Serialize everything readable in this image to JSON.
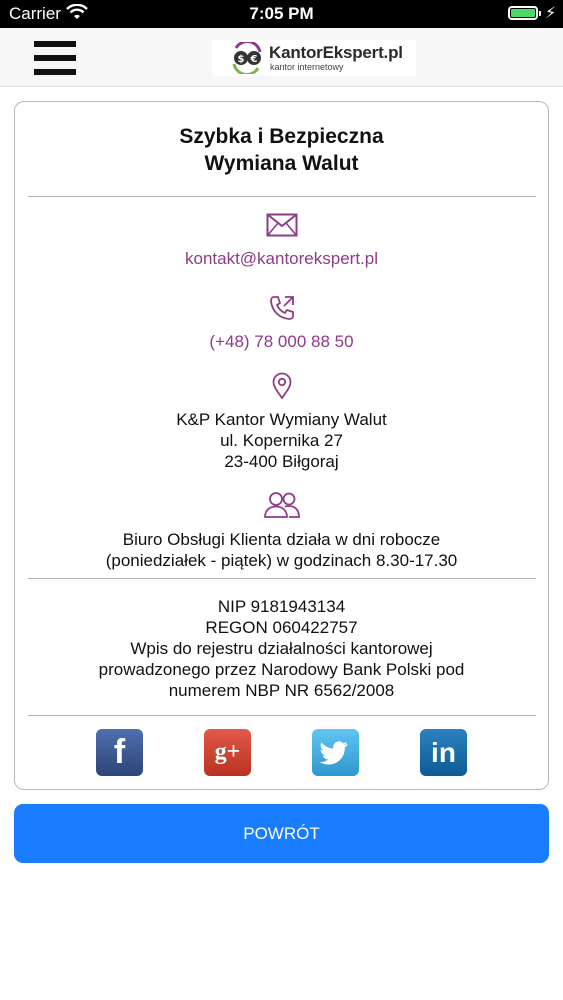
{
  "status_bar": {
    "carrier": "Carrier",
    "time": "7:05 PM",
    "battery_level": 1.0
  },
  "header": {
    "logo_title": "KantorEkspert.pl",
    "logo_subtitle": "kantor internetowy"
  },
  "card": {
    "heading_line1": "Szybka i Bezpieczna",
    "heading_line2": "Wymiana Walut",
    "email": "kontakt@kantorekspert.pl",
    "phone": "(+48) 78 000 88 50",
    "address": [
      "K&P Kantor Wymiany Walut",
      "ul. Kopernika 27",
      "23-400 Biłgoraj"
    ],
    "hours": [
      "Biuro Obsługi Klienta działa w dni robocze",
      "(poniedziałek - piątek) w godzinach 8.30-17.30"
    ],
    "company_info": [
      "NIP 9181943134",
      "REGON 060422757",
      "Wpis do rejestru działalności kantorowej",
      "prowadzonego przez Narodowy Bank Polski pod",
      "numerem NBP NR 6562/2008"
    ],
    "social": {
      "facebook": "f",
      "googleplus": "g+",
      "twitter": "twitter-bird",
      "linkedin": "in"
    }
  },
  "back_button": "POWRÓT",
  "colors": {
    "accent_purple": "#8e3b88",
    "button_blue": "#1a7cff",
    "battery_green": "#4cd964"
  },
  "icons": [
    "wifi-icon",
    "battery-icon",
    "hamburger-menu-icon",
    "envelope-icon",
    "phone-icon",
    "location-pin-icon",
    "users-icon"
  ]
}
